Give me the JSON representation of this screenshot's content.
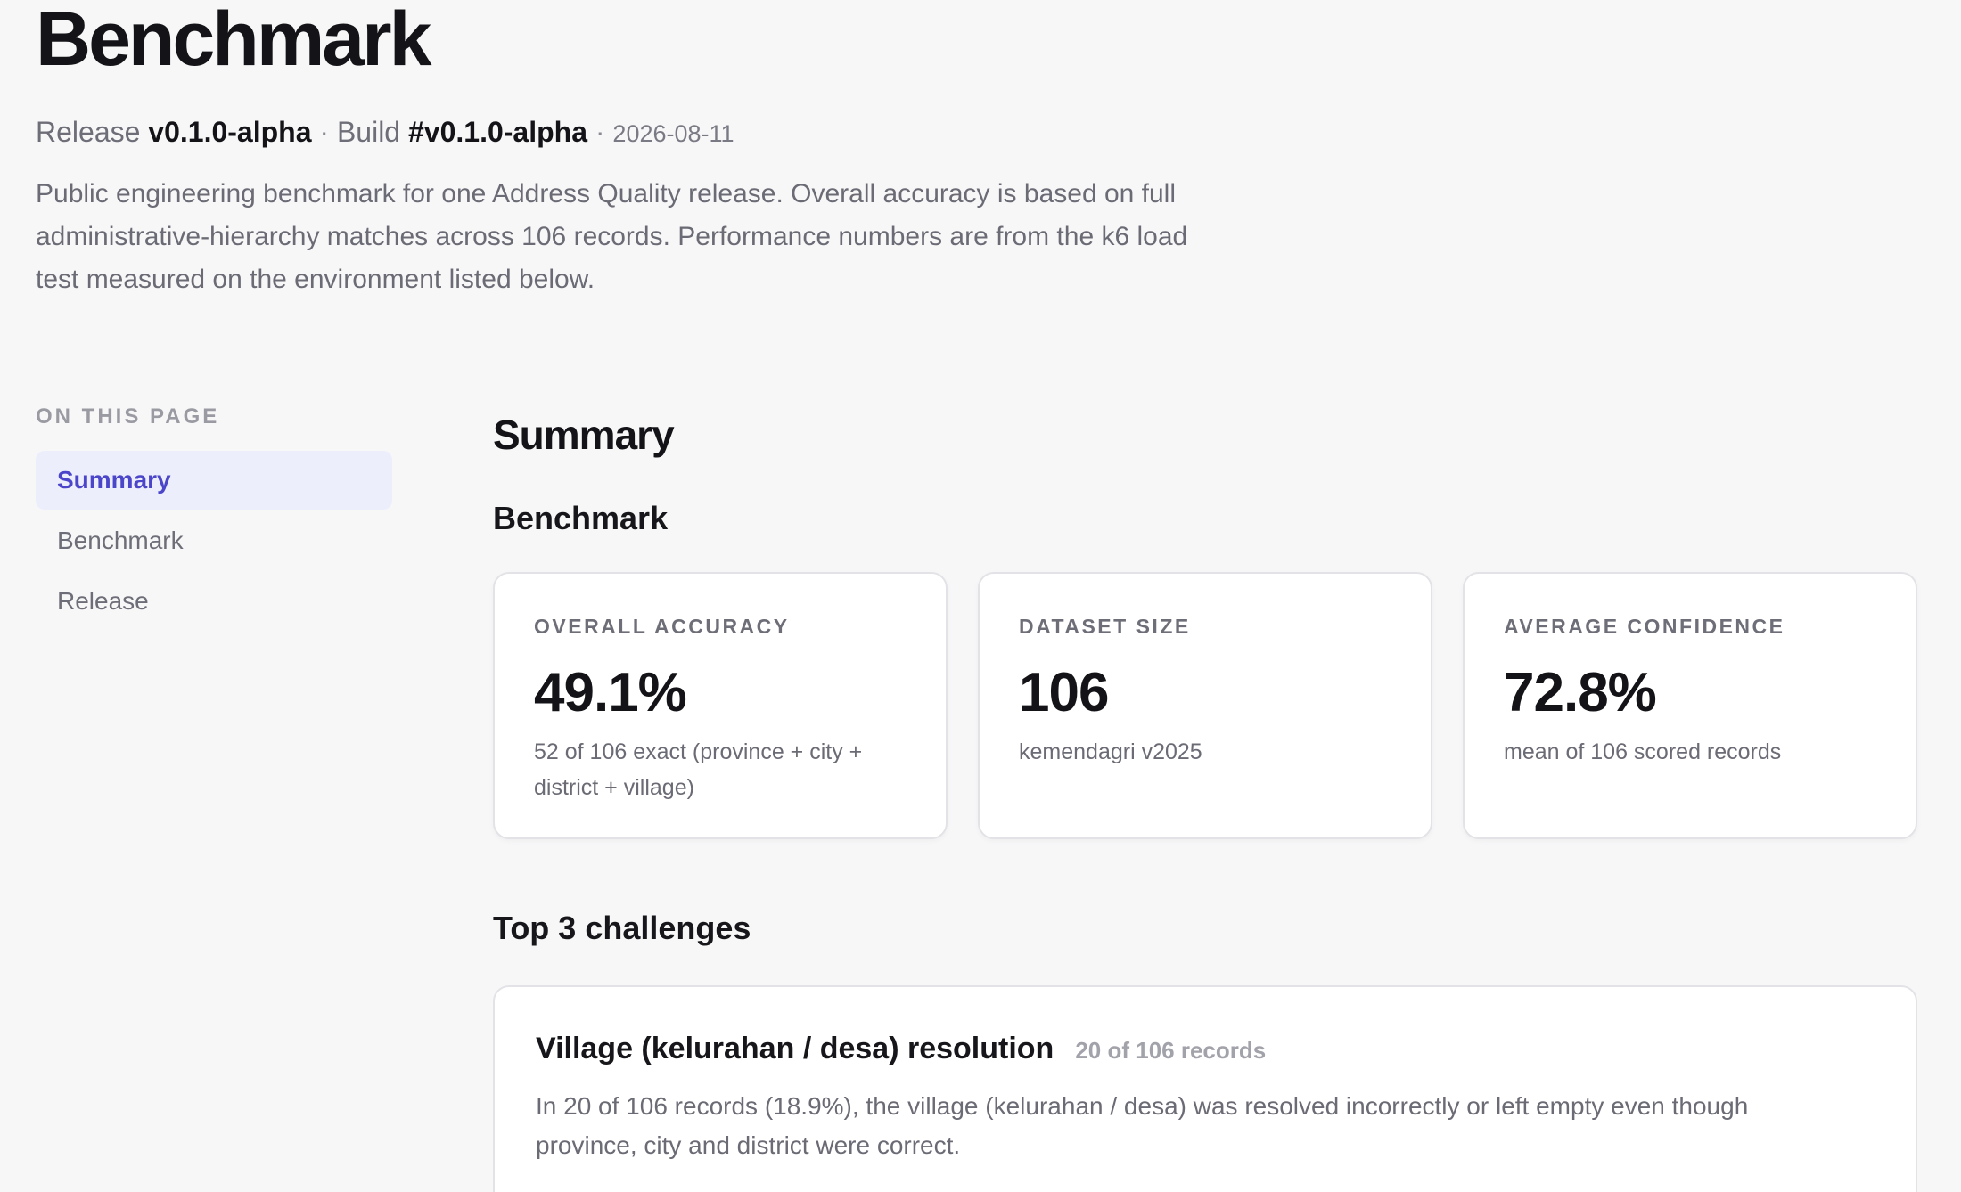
{
  "header": {
    "title": "Benchmark",
    "release_label": "Release",
    "release_value": "v0.1.0-alpha",
    "separator": "·",
    "build_label": "Build",
    "build_value": "#v0.1.0-alpha",
    "date": "2026-08-11",
    "intro": "Public engineering benchmark for one Address Quality release. Overall accuracy is based on full administrative-hierarchy matches across 106 records. Performance numbers are from the k6 load test measured on the environment listed below."
  },
  "toc": {
    "heading": "ON THIS PAGE",
    "items": [
      {
        "label": "Summary",
        "active": true
      },
      {
        "label": "Benchmark",
        "active": false
      },
      {
        "label": "Release",
        "active": false
      }
    ]
  },
  "main": {
    "summary_heading": "Summary",
    "benchmark_heading": "Benchmark",
    "cards": [
      {
        "label": "OVERALL ACCURACY",
        "value": "49.1%",
        "sub": "52 of 106 exact (province + city + district + village)"
      },
      {
        "label": "DATASET SIZE",
        "value": "106",
        "sub": "kemendagri v2025"
      },
      {
        "label": "AVERAGE CONFIDENCE",
        "value": "72.8%",
        "sub": "mean of 106 scored records"
      }
    ],
    "challenges_heading": "Top 3 challenges",
    "challenges": [
      {
        "title": "Village (kelurahan / desa) resolution",
        "count": "20 of 106 records",
        "description": "In 20 of 106 records (18.9%), the village (kelurahan / desa) was resolved incorrectly or left empty even though province, city and district were correct."
      }
    ]
  }
}
